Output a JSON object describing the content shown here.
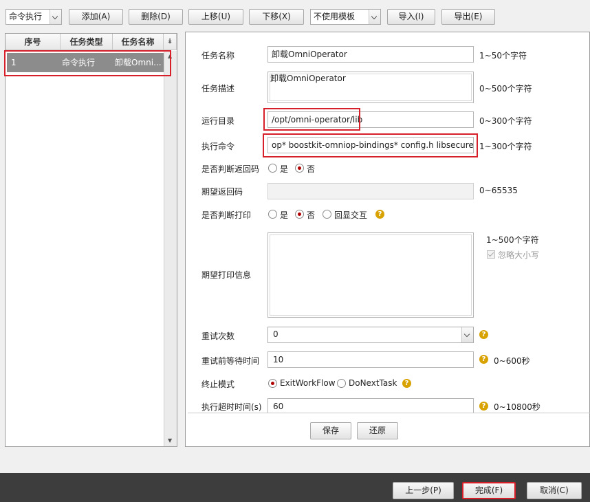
{
  "toolbar": {
    "task_type_select": "命令执行",
    "add": "添加(A)",
    "delete": "删除(D)",
    "move_up": "上移(U)",
    "move_down": "下移(X)",
    "template_select": "不使用模板",
    "import": "导入(I)",
    "export": "导出(E)"
  },
  "task_list": {
    "headers": [
      "序号",
      "任务类型",
      "任务名称"
    ],
    "rows": [
      {
        "index": "1",
        "type": "命令执行",
        "name": "卸载OmniOperator"
      }
    ],
    "row_display_name": "卸载Omni..."
  },
  "form": {
    "task_name_label": "任务名称",
    "task_name_value": "卸载OmniOperator",
    "task_name_hint": "1~50个字符",
    "task_desc_label": "任务描述",
    "task_desc_value": "卸载OmniOperator",
    "task_desc_hint": "0~500个字符",
    "run_dir_label": "运行目录",
    "run_dir_value": "/opt/omni-operator/lib",
    "run_dir_hint": "0~300个字符",
    "exec_cmd_label": "执行命令",
    "exec_cmd_value": "op* boostkit-omniop-bindings* config.h libsecurec.so;",
    "exec_cmd_hint": "1~300个字符",
    "judge_return_label": "是否判断返回码",
    "yes": "是",
    "no": "否",
    "expected_return_label": "期望返回码",
    "expected_return_value": "",
    "expected_return_hint": "0~65535",
    "judge_print_label": "是否判断打印",
    "echo_interact": "回显交互",
    "expected_print_label": "期望打印信息",
    "expected_print_value": "",
    "expected_print_hint": "1~500个字符",
    "ignore_case": "忽略大小写",
    "retry_count_label": "重试次数",
    "retry_count_value": "0",
    "retry_wait_label": "重试前等待时间",
    "retry_wait_value": "10",
    "retry_wait_hint": "0~600秒",
    "stop_mode_label": "终止模式",
    "stop_exit": "ExitWorkFlow",
    "stop_next": "DoNextTask",
    "timeout_label": "执行超时时间(s)",
    "timeout_value": "60",
    "timeout_hint": "0~10800秒"
  },
  "actions": {
    "save": "保存",
    "restore": "还原"
  },
  "footer": {
    "prev": "上一步(P)",
    "finish": "完成(F)",
    "cancel": "取消(C)"
  },
  "colors": {
    "highlight_border": "#d71f2a",
    "selected_row": "#8c8c8c",
    "radio_dot": "#b00000",
    "help_icon": "#d8a200",
    "footer_bar": "#3d3d3d"
  }
}
